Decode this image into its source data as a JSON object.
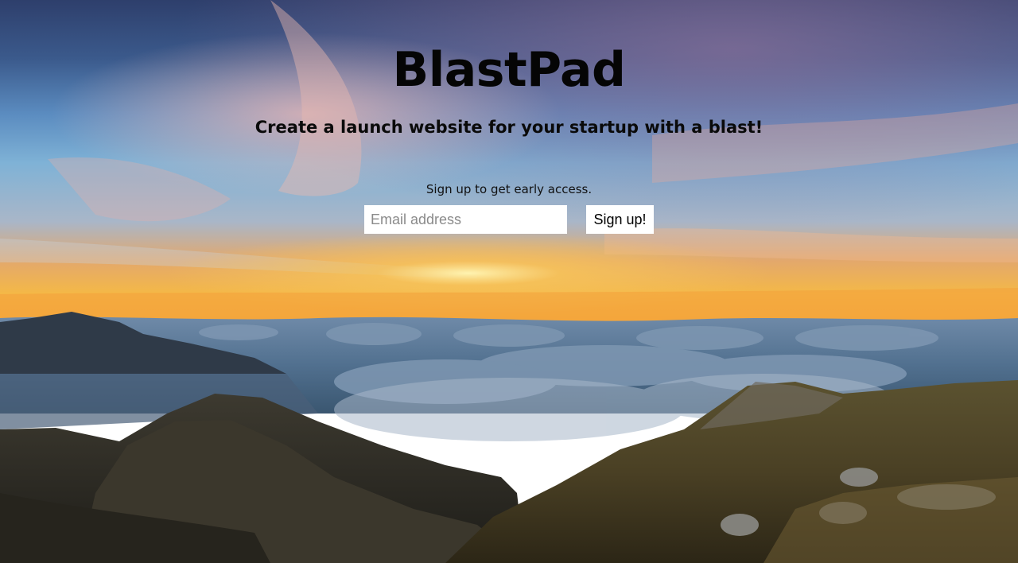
{
  "page": {
    "title": "BlastPad",
    "tagline": "Create a launch website for your startup with a blast!",
    "signup_prompt": "Sign up to get early access."
  },
  "form": {
    "email_placeholder": "Email address",
    "submit_label": "Sign up!"
  },
  "background": {
    "description_icon": "mountain-sunrise-background"
  }
}
